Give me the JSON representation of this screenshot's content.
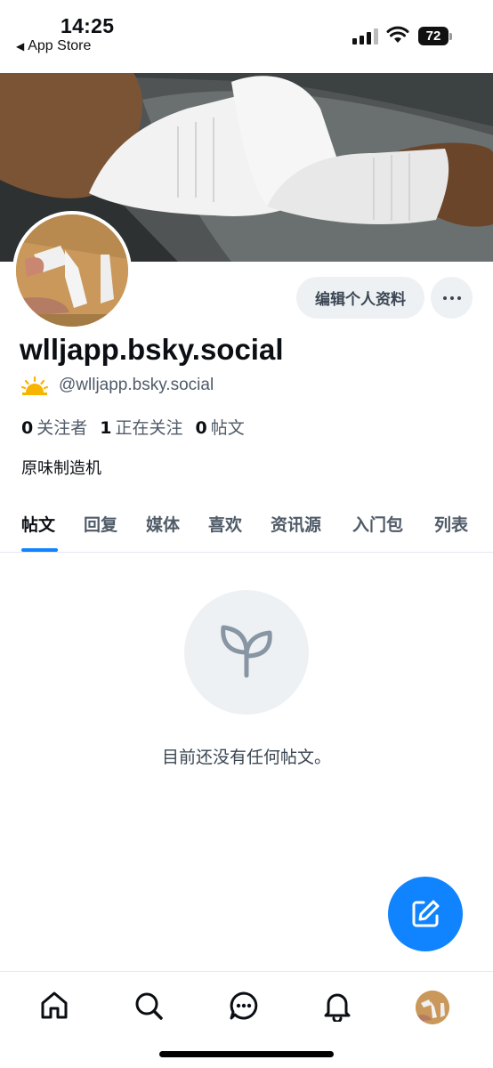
{
  "status_bar": {
    "time": "14:25",
    "back_label": "App Store",
    "battery": "72"
  },
  "profile": {
    "display_name": "wlljapp.bsky.social",
    "handle": "@wlljapp.bsky.social",
    "handle_emoji": "sunrise-icon",
    "followers_count": "0",
    "followers_label": "关注者",
    "following_count": "1",
    "following_label": "正在关注",
    "posts_count": "0",
    "posts_label": "帖文",
    "bio": "原味制造机",
    "edit_label": "编辑个人资料"
  },
  "tabs": [
    {
      "label": "帖文",
      "active": true
    },
    {
      "label": "回复"
    },
    {
      "label": "媒体"
    },
    {
      "label": "喜欢"
    },
    {
      "label": "资讯源"
    },
    {
      "label": "入门包"
    },
    {
      "label": "列表"
    }
  ],
  "empty_state": {
    "icon": "sprout-icon",
    "message": "目前还没有任何帖文。"
  },
  "bottom_nav": [
    "home-icon",
    "search-icon",
    "chat-icon",
    "bell-icon",
    "profile-avatar"
  ],
  "colors": {
    "accent": "#1083fe",
    "muted_text": "#4f5b68",
    "button_bg": "#eef1f4"
  }
}
